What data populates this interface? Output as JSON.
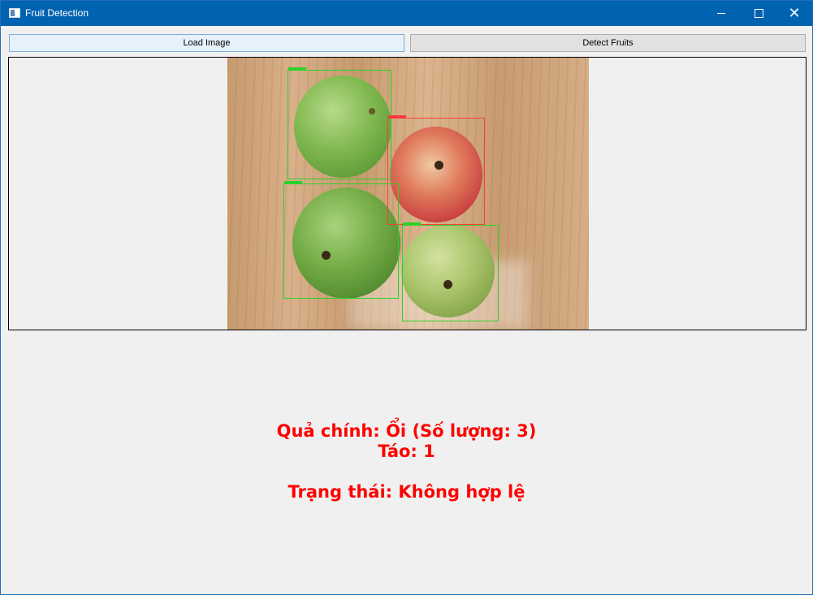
{
  "window": {
    "title": "Fruit Detection"
  },
  "toolbar": {
    "load_label": "Load Image",
    "detect_label": "Detect Fruits"
  },
  "image": {
    "detections": [
      {
        "class": "guava",
        "box_color": "#2bd12b"
      },
      {
        "class": "apple",
        "box_color": "#ff3a3a"
      },
      {
        "class": "guava",
        "box_color": "#2bd12b"
      },
      {
        "class": "guava",
        "box_color": "#2bd12b"
      }
    ]
  },
  "result": {
    "main_fruit": "Quả chính: Ổi (Số lượng: 3)",
    "apple_count": "Táo: 1",
    "status": "Trạng thái: Không hợp lệ",
    "text_color": "#ff0000"
  },
  "icons": {
    "app": "app-window-icon",
    "minimize": "minimize-icon",
    "maximize": "maximize-icon",
    "close": "close-icon"
  }
}
